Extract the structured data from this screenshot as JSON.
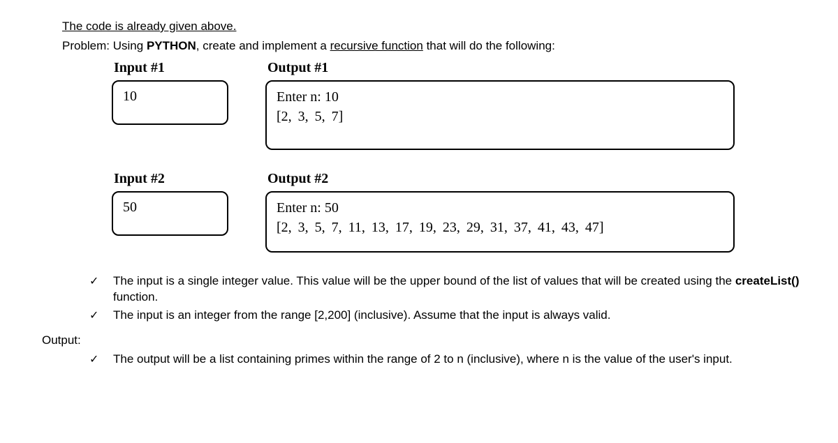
{
  "intro_line": "The code is already given above.",
  "problem_prefix": "Problem: Using ",
  "problem_language": "PYTHON",
  "problem_mid": ", create and implement a ",
  "problem_underlined": "recursive function",
  "problem_suffix": " that will do the following:",
  "examples": [
    {
      "input_heading": "Input #1",
      "output_heading": "Output #1",
      "input_value": "10",
      "output_enter": "Enter n: 10",
      "output_list": "[2, 3, 5, 7]"
    },
    {
      "input_heading": "Input #2",
      "output_heading": "Output #2",
      "input_value": "50",
      "output_enter": "Enter n: 50",
      "output_list": "[2, 3, 5, 7, 11, 13, 17, 19, 23, 29, 31, 37, 41, 43, 47]"
    }
  ],
  "checks_input": [
    {
      "pre": "The input is a single integer value. This value will be the upper bound of the list of values that will be created using the ",
      "func": "createList()",
      "post": " function."
    },
    {
      "text": "The input is an integer from the range [2,200] (inclusive). Assume that the input is always valid."
    }
  ],
  "output_label": "Output:",
  "checks_output": [
    {
      "text": "The output will be a list containing primes within the range of 2 to n (inclusive), where n is the value of the user's  input."
    }
  ],
  "check_glyph": "✓"
}
